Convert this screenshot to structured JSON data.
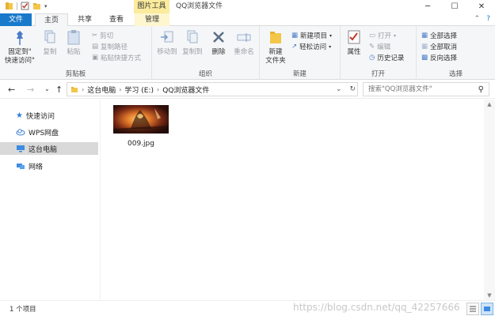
{
  "window": {
    "context_tab": "图片工具",
    "title": "QQ浏览器文件",
    "controls": {
      "minimize": "─",
      "maximize": "☐",
      "close": "✕"
    }
  },
  "tabs": {
    "file": "文件",
    "home": "主页",
    "share": "共享",
    "view": "查看",
    "manage": "管理"
  },
  "ribbon": {
    "clipboard": {
      "label": "剪贴板",
      "pin": "固定到\"\n快速访问\"",
      "copy": "复制",
      "paste": "粘贴",
      "cut": "剪切",
      "copy_path": "复制路径",
      "paste_shortcut": "粘贴快捷方式"
    },
    "organize": {
      "label": "组织",
      "move_to": "移动到",
      "copy_to": "复制到",
      "delete": "删除",
      "rename": "重命名"
    },
    "new": {
      "label": "新建",
      "new_folder": "新建\n文件夹",
      "new_item": "新建项目",
      "easy_access": "轻松访问"
    },
    "open": {
      "label": "打开",
      "properties": "属性",
      "open": "打开",
      "edit": "编辑",
      "history": "历史记录"
    },
    "select": {
      "label": "选择",
      "select_all": "全部选择",
      "select_none": "全部取消",
      "invert": "反向选择"
    }
  },
  "address": {
    "breadcrumb": [
      "这台电脑",
      "学习 (E:)",
      "QQ浏览器文件"
    ],
    "search_placeholder": "搜索\"QQ浏览器文件\""
  },
  "navpane": {
    "items": [
      {
        "label": "快速访问",
        "icon": "star-icon",
        "selected": false
      },
      {
        "label": "WPS网盘",
        "icon": "cloud-icon",
        "selected": false
      },
      {
        "label": "这台电脑",
        "icon": "computer-icon",
        "selected": true
      },
      {
        "label": "网络",
        "icon": "network-icon",
        "selected": false
      }
    ]
  },
  "files": [
    {
      "name": "009.jpg"
    }
  ],
  "status": {
    "count": "1 个项目",
    "watermark": "https://blog.csdn.net/qq_42257666"
  },
  "colors": {
    "file_tab": "#1979ca",
    "context_tab": "#fbeb9c",
    "selected_nav": "#d9d9d9"
  }
}
